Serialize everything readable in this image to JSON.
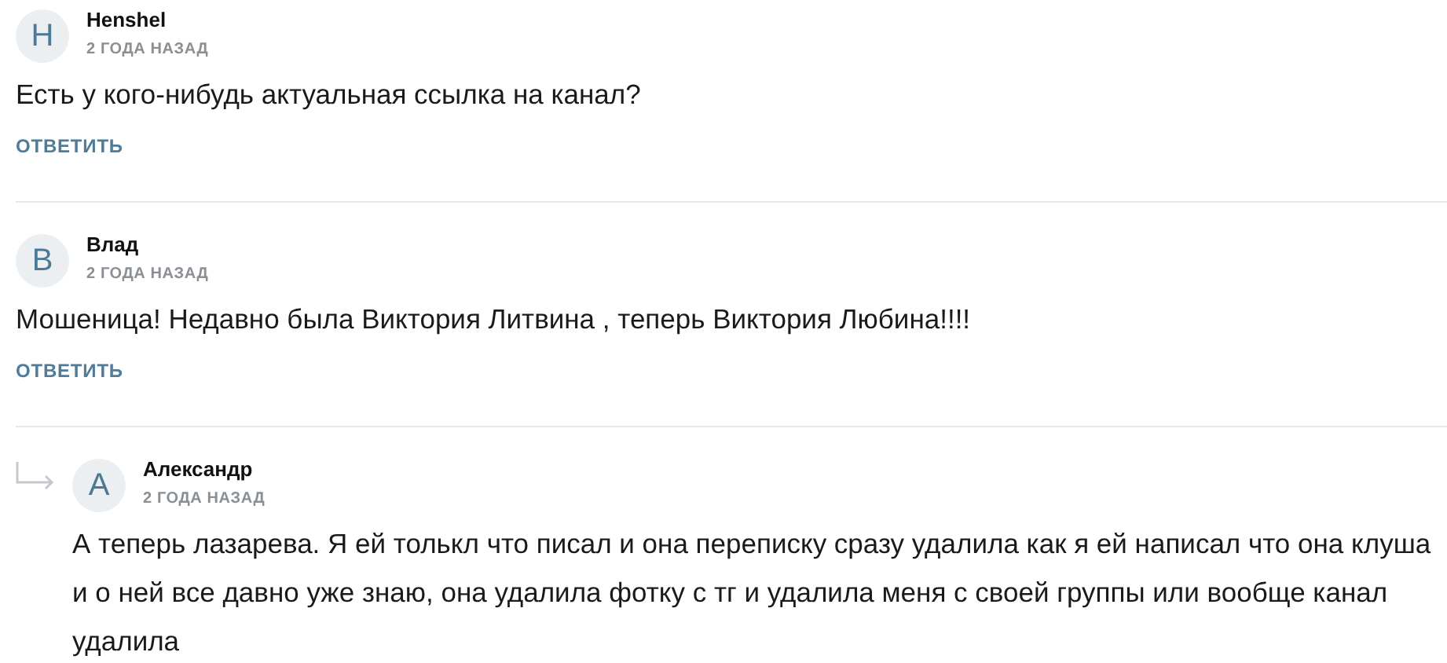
{
  "comments": [
    {
      "avatar_letter": "H",
      "author": "Henshel",
      "time": "2 ГОДА НАЗАД",
      "text": "Есть у кого-нибудь актуальная ссылка на канал?",
      "reply_button": "ОТВЕТИТЬ"
    },
    {
      "avatar_letter": "В",
      "author": "Влад",
      "time": "2 ГОДА НАЗАД",
      "text": "Мошеница! Недавно была Виктория Литвина , теперь Виктория Любина!!!!",
      "reply_button": "ОТВЕТИТЬ",
      "replies": [
        {
          "avatar_letter": "А",
          "author": "Александр",
          "time": "2 ГОДА НАЗАД",
          "text": "А теперь лазарева. Я ей толькл что писал и она переписку сразу удалила как я ей написал что она клуша и о ней все давно уже знаю, она удалила фотку с тг и удалила меня с своей группы или вообще канал удалила"
        }
      ]
    }
  ]
}
